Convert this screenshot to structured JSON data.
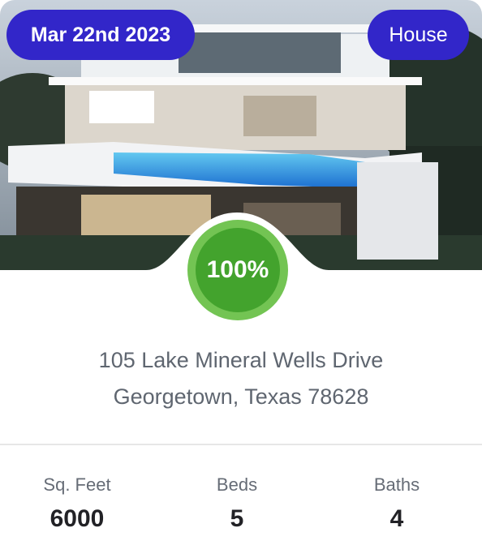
{
  "listing": {
    "date": "Mar 22nd 2023",
    "type": "House",
    "score": "100%",
    "address_line1": "105 Lake Mineral Wells Drive",
    "address_line2": "Georgetown, Texas 78628"
  },
  "stats": {
    "sqft_label": "Sq. Feet",
    "sqft_value": "6000",
    "beds_label": "Beds",
    "beds_value": "5",
    "baths_label": "Baths",
    "baths_value": "4"
  },
  "colors": {
    "pill": "#3226c9",
    "score_ring": "#73c453",
    "score_fill": "#43a32d"
  }
}
